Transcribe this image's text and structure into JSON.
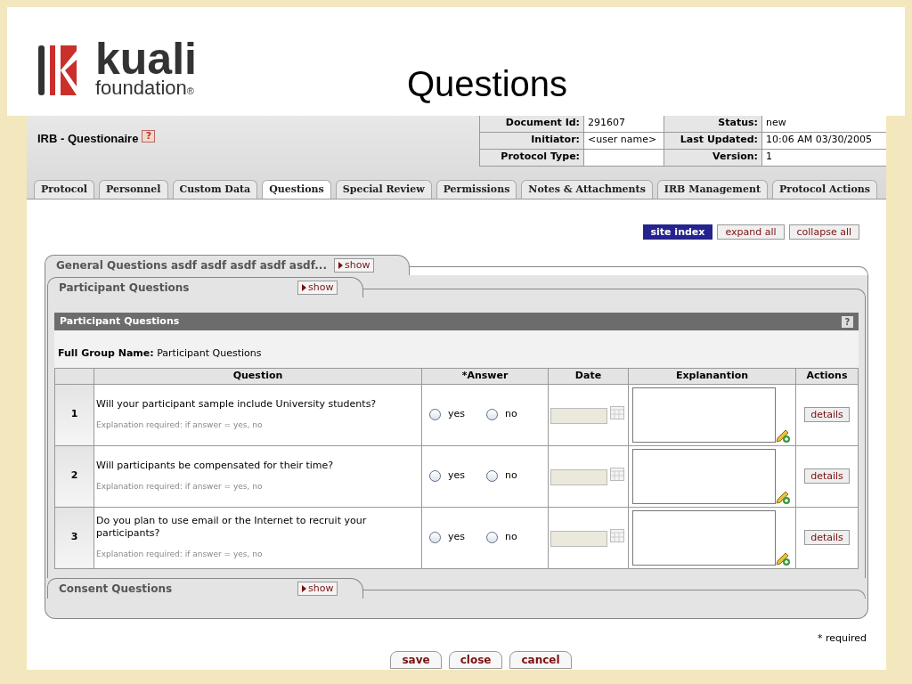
{
  "logo": {
    "word": "kuali",
    "subword": "foundation",
    "mark": "®"
  },
  "slide_title": "Questions",
  "document": {
    "title": "IRB - Questionaire",
    "help": "?"
  },
  "info": [
    {
      "label": "Document Id:",
      "value": "291607",
      "label2": "Status:",
      "value2": "new"
    },
    {
      "label": "Initiator:",
      "value": "<user name>",
      "label2": "Last Updated:",
      "value2": "10:06 AM 03/30/2005"
    },
    {
      "label": "Protocol Type:",
      "label2": "Version:",
      "value2": "1"
    }
  ],
  "tabs": [
    {
      "label": "Protocol",
      "selected": false
    },
    {
      "label": "Personnel",
      "selected": false
    },
    {
      "label": "Custom Data",
      "selected": false
    },
    {
      "label": "Questions",
      "selected": true
    },
    {
      "label": "Special Review",
      "selected": false
    },
    {
      "label": "Permissions",
      "selected": false
    },
    {
      "label": "Notes & Attachments",
      "selected": false
    },
    {
      "label": "IRB Management",
      "selected": false
    },
    {
      "label": "Protocol Actions",
      "selected": false
    }
  ],
  "top_buttons": [
    {
      "label": "site index",
      "kind": "primary"
    },
    {
      "label": "expand all",
      "kind": "plain"
    },
    {
      "label": "collapse all",
      "kind": "plain"
    }
  ],
  "general_section": {
    "title": "General Questions asdf asdf asdf asdf asdf...",
    "toggle": "show"
  },
  "participant_section": {
    "title": "Participant Questions",
    "toggle": "show",
    "header": "Participant Questions",
    "help": "?",
    "group_label": "Full Group Name:",
    "group_value": "Participant Questions"
  },
  "table": {
    "columns": [
      "Question",
      "*Answer",
      "Date",
      "Explanantion",
      "Actions"
    ],
    "rows": [
      {
        "number": "1",
        "question": "Will your participant sample include University students?",
        "note": "Explanation required: if answer = yes, no",
        "options": [
          {
            "label": "yes",
            "selected": false
          },
          {
            "label": "no",
            "selected": false
          }
        ],
        "action": "details"
      },
      {
        "number": "2",
        "question": "Will participants be compensated for their time?",
        "note": "Explanation required: if answer = yes, no",
        "options": [
          {
            "label": "yes",
            "selected": false
          },
          {
            "label": "no",
            "selected": false
          }
        ],
        "action": "details"
      },
      {
        "number": "3",
        "question": "Do you plan to use email or the Internet to recruit your participants?",
        "note": "Explanation required: if answer = yes, no",
        "options": [
          {
            "label": "yes",
            "selected": false
          },
          {
            "label": "no",
            "selected": false
          }
        ],
        "action": "details"
      }
    ]
  },
  "consent_section": {
    "title": "Consent Questions",
    "toggle": "show"
  },
  "required_note": "* required",
  "bottom_buttons": [
    "save",
    "close",
    "cancel"
  ]
}
